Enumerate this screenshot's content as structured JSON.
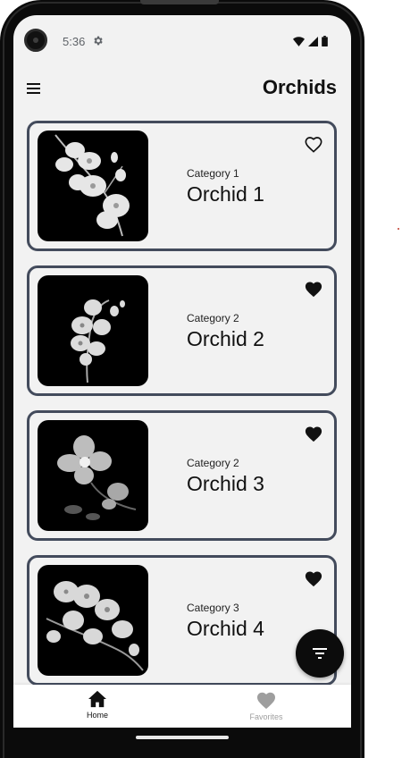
{
  "status_bar": {
    "time": "5:36",
    "icons": [
      "settings-gear-icon",
      "wifi-icon",
      "signal-icon",
      "battery-icon"
    ]
  },
  "app_bar": {
    "title": "Orchids",
    "menu_icon": "hamburger-menu-icon"
  },
  "orchids": [
    {
      "category": "Category 1",
      "name": "Orchid 1",
      "favorite": false
    },
    {
      "category": "Category 2",
      "name": "Orchid 2",
      "favorite": true
    },
    {
      "category": "Category 2",
      "name": "Orchid 3",
      "favorite": true
    },
    {
      "category": "Category 3",
      "name": "Orchid 4",
      "favorite": true
    }
  ],
  "fab": {
    "icon": "filter-icon"
  },
  "bottom_nav": {
    "home_label": "Home",
    "favorites_label": "Favorites",
    "active": "home"
  },
  "colors": {
    "background": "#f2f2f2",
    "card_border": "#434b5c",
    "text": "#111111",
    "inactive_nav": "#9e9e9e"
  }
}
